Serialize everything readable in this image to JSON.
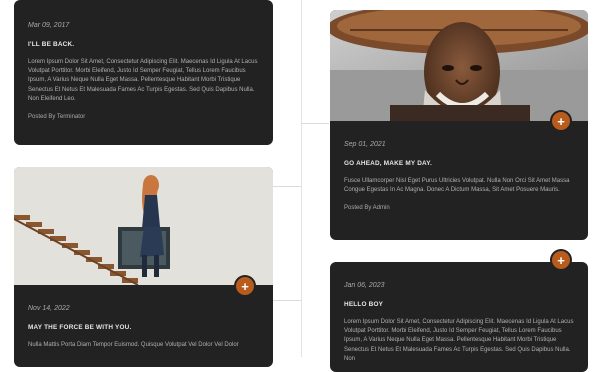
{
  "posts": [
    {
      "date": "Mar 09, 2017",
      "title": "I'LL BE BACK.",
      "text": "Lorem Ipsum Dolor Sit Amet, Consectetur Adipiscing Elit. Maecenas Id Ligula At Lacus Volutpat Porttitor. Morbi Eleifend, Justo Id Semper Feugiat, Tellus Lorem Faucibus Ipsum, A Varius Neque Nulla Eget Massa. Pellentesque Habitant Morbi Tristique Senectus Et Netus Et Malesuada Fames Ac Turpis Egestas. Sed Quis Dapibus Nulla. Non Eleifend Leo.",
      "author": "Posted By Terminator"
    },
    {
      "date": "Sep 01, 2021",
      "title": "GO AHEAD, MAKE MY DAY.",
      "text": "Fusce Ullamcorper Nisl Eget Purus Ultricies Volutpat. Nulla Non Orci Sit Amet Massa Congue Egestas In Ac Magna. Donec A Dictum Massa, Sit Amet Posuere Mauris.",
      "author": "Posted By Admin"
    },
    {
      "date": "Nov 14, 2022",
      "title": "MAY THE FORCE BE WITH YOU.",
      "text": "Nulla Mattis Porta Diam Tempor Euismod. Quisque Volutpat Vel Dolor Vel Dolor"
    },
    {
      "date": "Jan 06, 2023",
      "title": "HELLO BOY",
      "text": "Lorem Ipsum Dolor Sit Amet, Consectetur Adipiscing Elit. Maecenas Id Ligula At Lacus Volutpat Porttitor. Morbi Eleifend, Justo Id Semper Feugiat, Tellus Lorem Faucibus Ipsum, A Varius Neque Nulla Eget Massa. Pellentesque Habitant Morbi Tristique Senectus Et Netus Et Malesuada Fames Ac Turpis Egestas. Sed Quis Dapibus Nulla. Non"
    }
  ],
  "icons": {
    "expand": "plus-icon"
  },
  "colors": {
    "card_bg": "#222222",
    "accent": "#b85c1e",
    "page_bg": "#ffffff"
  }
}
